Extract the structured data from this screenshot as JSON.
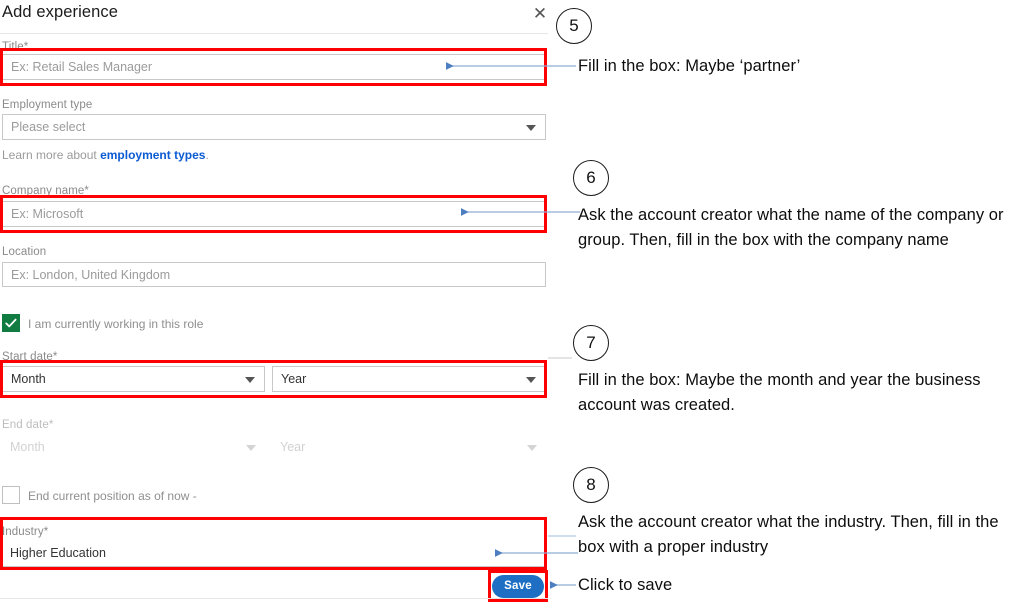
{
  "dialog": {
    "title": "Add experience",
    "close_icon": "close-icon",
    "fields": {
      "title": {
        "label": "Title*",
        "placeholder": "Ex: Retail Sales Manager",
        "value": "",
        "highlighted": true
      },
      "employment_type": {
        "label": "Employment type",
        "selected": "Please select",
        "highlighted": false
      },
      "company_name": {
        "label": "Company name*",
        "placeholder": "Ex: Microsoft",
        "value": "",
        "highlighted": true
      },
      "location": {
        "label": "Location",
        "placeholder": "Ex: London, United Kingdom",
        "value": "",
        "highlighted": false
      },
      "start_date": {
        "label": "Start date*",
        "month_selected": "Month",
        "year_selected": "Year",
        "highlighted": true
      },
      "end_date": {
        "label": "End date*",
        "month_selected": "Month",
        "year_selected": "Year",
        "disabled": true,
        "highlighted": false
      },
      "industry": {
        "label": "Industry*",
        "value": "Higher Education",
        "highlighted": true
      }
    },
    "learn_more": {
      "prefix": "Learn more about ",
      "link": "employment types",
      "suffix": "."
    },
    "checkboxes": {
      "currently_working": {
        "label": "I am currently working in this role",
        "checked": true
      },
      "end_current_position": {
        "label": "End current position as of now -",
        "checked": false
      }
    },
    "save_label": "Save"
  },
  "annotations": [
    {
      "number": "5",
      "text": "Fill in the box: Maybe ‘partner’"
    },
    {
      "number": "6",
      "text": "Ask the account creator what the name of the company or group. Then, fill in the box with the company name"
    },
    {
      "number": "7",
      "text": "Fill in the box: Maybe the month and year the business account was created."
    },
    {
      "number": "8",
      "text": "Ask the account creator what the industry. Then, fill in the box with a proper industry"
    }
  ],
  "save_note": "Click to save",
  "colors": {
    "highlight": "#ff0000",
    "arrow": "#5b87c7",
    "accent_link": "#0b5bd3",
    "checkbox_checked": "#107c41",
    "save_button": "#1e6fc4"
  }
}
